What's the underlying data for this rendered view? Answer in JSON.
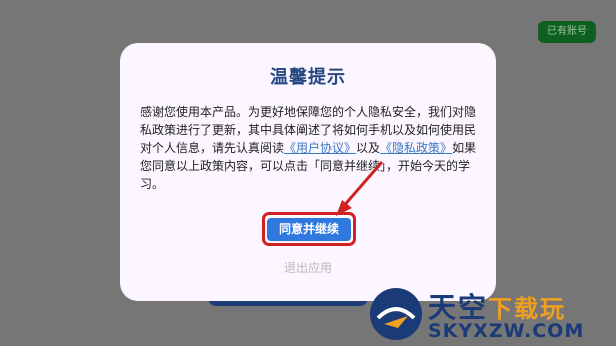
{
  "background": {
    "top_right_button": "已有账号"
  },
  "dialog": {
    "title": "温馨提示",
    "text_1": "感谢您使用本产品。为更好地保障您的个人隐私安全，我们对隐私政策进行了更新，其中具体阐述了将如何手机以及如何使用民对个人信息，请先认真阅读",
    "link_user_agreement": "《用户协议》",
    "text_2": "以及",
    "link_privacy_policy": "《隐私政策》",
    "text_3": "如果您同意以上政策内容，可以点击「同意并继续」，开始今天的学习。",
    "agree_button": "同意并继续",
    "exit_button": "退出应用"
  },
  "watermark": {
    "brand": "天空",
    "brand_suffix": "下载玩",
    "domain": "SKYXZW.COM"
  },
  "colors": {
    "overlay": "#767676",
    "dialog_bg": "#fbf6ff",
    "title": "#23477f",
    "link": "#3b79c4",
    "primary": "#2f79de",
    "highlight": "#d02222"
  }
}
